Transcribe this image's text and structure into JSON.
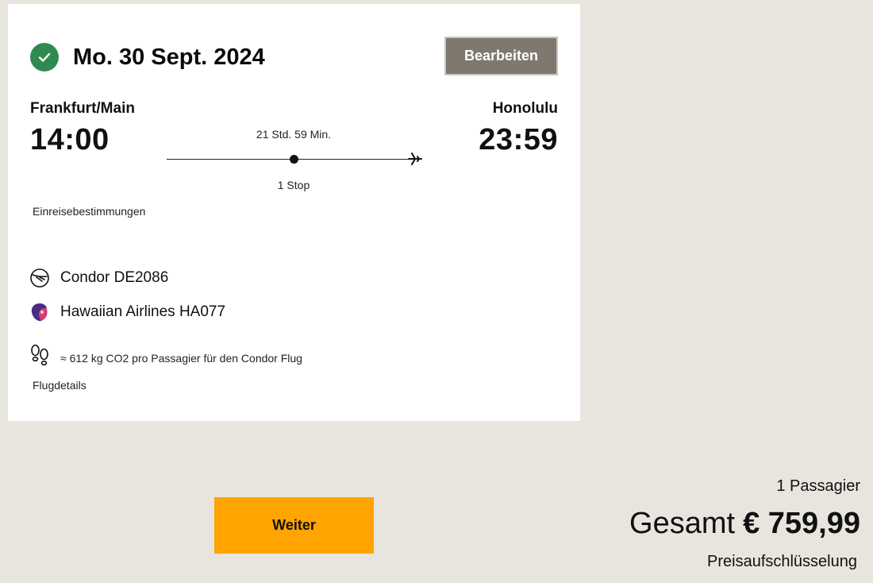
{
  "flight": {
    "date": "Mo. 30 Sept. 2024",
    "edit_label": "Bearbeiten",
    "origin": {
      "city": "Frankfurt/Main",
      "time": "14:00"
    },
    "destination": {
      "city": "Honolulu",
      "time": "23:59"
    },
    "duration": "21 Std. 59 Min.",
    "stops": "1 Stop",
    "entry_requirements": "Einreisebestimmungen",
    "carriers": [
      {
        "name": "Condor DE2086",
        "icon": "condor-logo-icon"
      },
      {
        "name": "Hawaiian Airlines HA077",
        "icon": "hawaiian-logo-icon"
      }
    ],
    "co2": {
      "text": "≈ 612 kg CO2 pro Passagier für den Condor Flug",
      "icon": "footprints-icon"
    },
    "details_link": "Flugdetails"
  },
  "summary": {
    "continue_label": "Weiter",
    "passengers": "1 Passagier",
    "total_label": "Gesamt",
    "total_amount": "€ 759,99",
    "breakdown_link": "Preisaufschlüsselung"
  },
  "colors": {
    "background": "#e8e5de",
    "check_green": "#2f8a52",
    "edit_button": "#7f786f",
    "continue_button": "#ffa400"
  }
}
